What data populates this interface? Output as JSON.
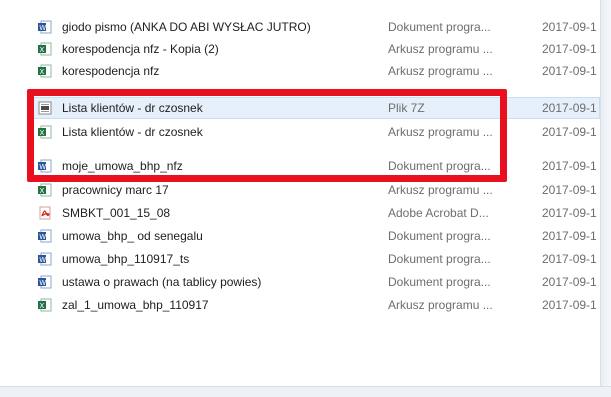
{
  "files": [
    {
      "name": "giodo pismo (ANKA DO ABI WYSŁAC JUTRO)",
      "type": "Dokument progra...",
      "date": "2017-09-1",
      "icon": "word-doc-icon"
    },
    {
      "name": "korespodencja nfz - Kopia (2)",
      "type": "Arkusz programu ...",
      "date": "2017-09-1",
      "icon": "excel-sheet-icon"
    },
    {
      "name": "korespodencja nfz",
      "type": "Arkusz programu ...",
      "date": "2017-09-1",
      "icon": "excel-sheet-icon"
    },
    {
      "name": "Lista klientów - dr czosnek",
      "type": "Plik 7Z",
      "date": "2017-09-1",
      "icon": "archive-7z-icon"
    },
    {
      "name": "Lista klientów - dr czosnek",
      "type": "Arkusz programu ...",
      "date": "2017-09-1",
      "icon": "excel-sheet-icon"
    },
    {
      "name": "moje_umowa_bhp_nfz",
      "type": "Dokument progra...",
      "date": "2017-09-1",
      "icon": "word-doc-icon"
    },
    {
      "name": "pracownicy marc 17",
      "type": "Arkusz programu ...",
      "date": "2017-09-1",
      "icon": "excel-sheet-icon"
    },
    {
      "name": "SMBKT_001_15_08",
      "type": "Adobe Acrobat D...",
      "date": "2017-09-1",
      "icon": "pdf-icon"
    },
    {
      "name": "umowa_bhp_ od senegalu",
      "type": "Dokument progra...",
      "date": "2017-09-1",
      "icon": "word-doc-icon"
    },
    {
      "name": "umowa_bhp_110917_ts",
      "type": "Dokument progra...",
      "date": "2017-09-1",
      "icon": "word-doc-icon"
    },
    {
      "name": "ustawa o prawach (na tablicy powies)",
      "type": "Dokument progra...",
      "date": "2017-09-1",
      "icon": "word-doc-icon"
    },
    {
      "name": "zal_1_umowa_bhp_110917",
      "type": "Arkusz programu ...",
      "date": "2017-09-1",
      "icon": "excel-sheet-icon"
    }
  ],
  "colors": {
    "annotation": "#e8101f",
    "selected_row": "#e5f0fb",
    "word": "#2b579a",
    "excel": "#217346",
    "pdf": "#d8261a"
  }
}
